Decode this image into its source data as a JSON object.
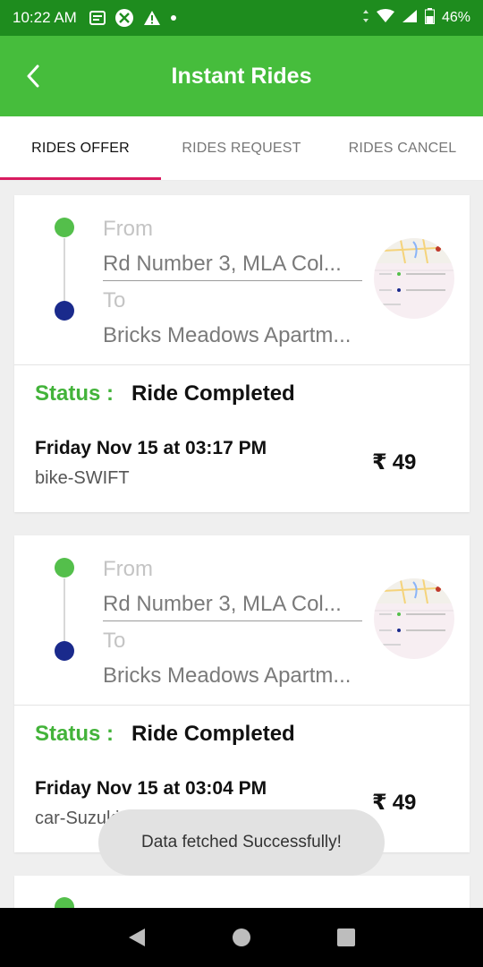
{
  "status_bar": {
    "time": "10:22 AM",
    "battery": "46%",
    "icons": [
      "notification-icon",
      "compass-icon",
      "warning-icon",
      "dot-icon",
      "data-arrows-icon",
      "wifi-icon",
      "signal-icon",
      "battery-icon"
    ]
  },
  "app_bar": {
    "title": "Instant Rides",
    "back_icon": "chevron-left-icon"
  },
  "tabs": [
    {
      "label": "RIDES OFFER",
      "active": true
    },
    {
      "label": "RIDES REQUEST",
      "active": false
    },
    {
      "label": "RIDES CANCEL",
      "active": false
    }
  ],
  "rides": [
    {
      "from_label": "From",
      "from_address": "Rd Number 3, MLA Col...",
      "to_label": "To",
      "to_address": "Bricks Meadows Apartm...",
      "status_label": "Status :",
      "status_value": "Ride Completed",
      "datetime": "Friday Nov 15 at 03:17 PM",
      "vehicle": "bike-SWIFT",
      "currency": "₹",
      "price": "49"
    },
    {
      "from_label": "From",
      "from_address": "Rd Number 3, MLA Col...",
      "to_label": "To",
      "to_address": "Bricks Meadows Apartm...",
      "status_label": "Status :",
      "status_value": "Ride Completed",
      "datetime": "Friday Nov 15 at 03:04 PM",
      "vehicle": "car-Suzuki",
      "currency": "₹",
      "price": "49"
    }
  ],
  "toast": {
    "message": "Data fetched Successfully!"
  },
  "nav_bar": {
    "icons": [
      "back-triangle-icon",
      "home-circle-icon",
      "recents-square-icon"
    ]
  },
  "colors": {
    "status_bar": "#1e8c1e",
    "app_bar": "#46bd3c",
    "tab_indicator": "#d81b60",
    "from_dot": "#54bf4b",
    "to_dot": "#1a2a8c",
    "status_label": "#43b33a"
  }
}
